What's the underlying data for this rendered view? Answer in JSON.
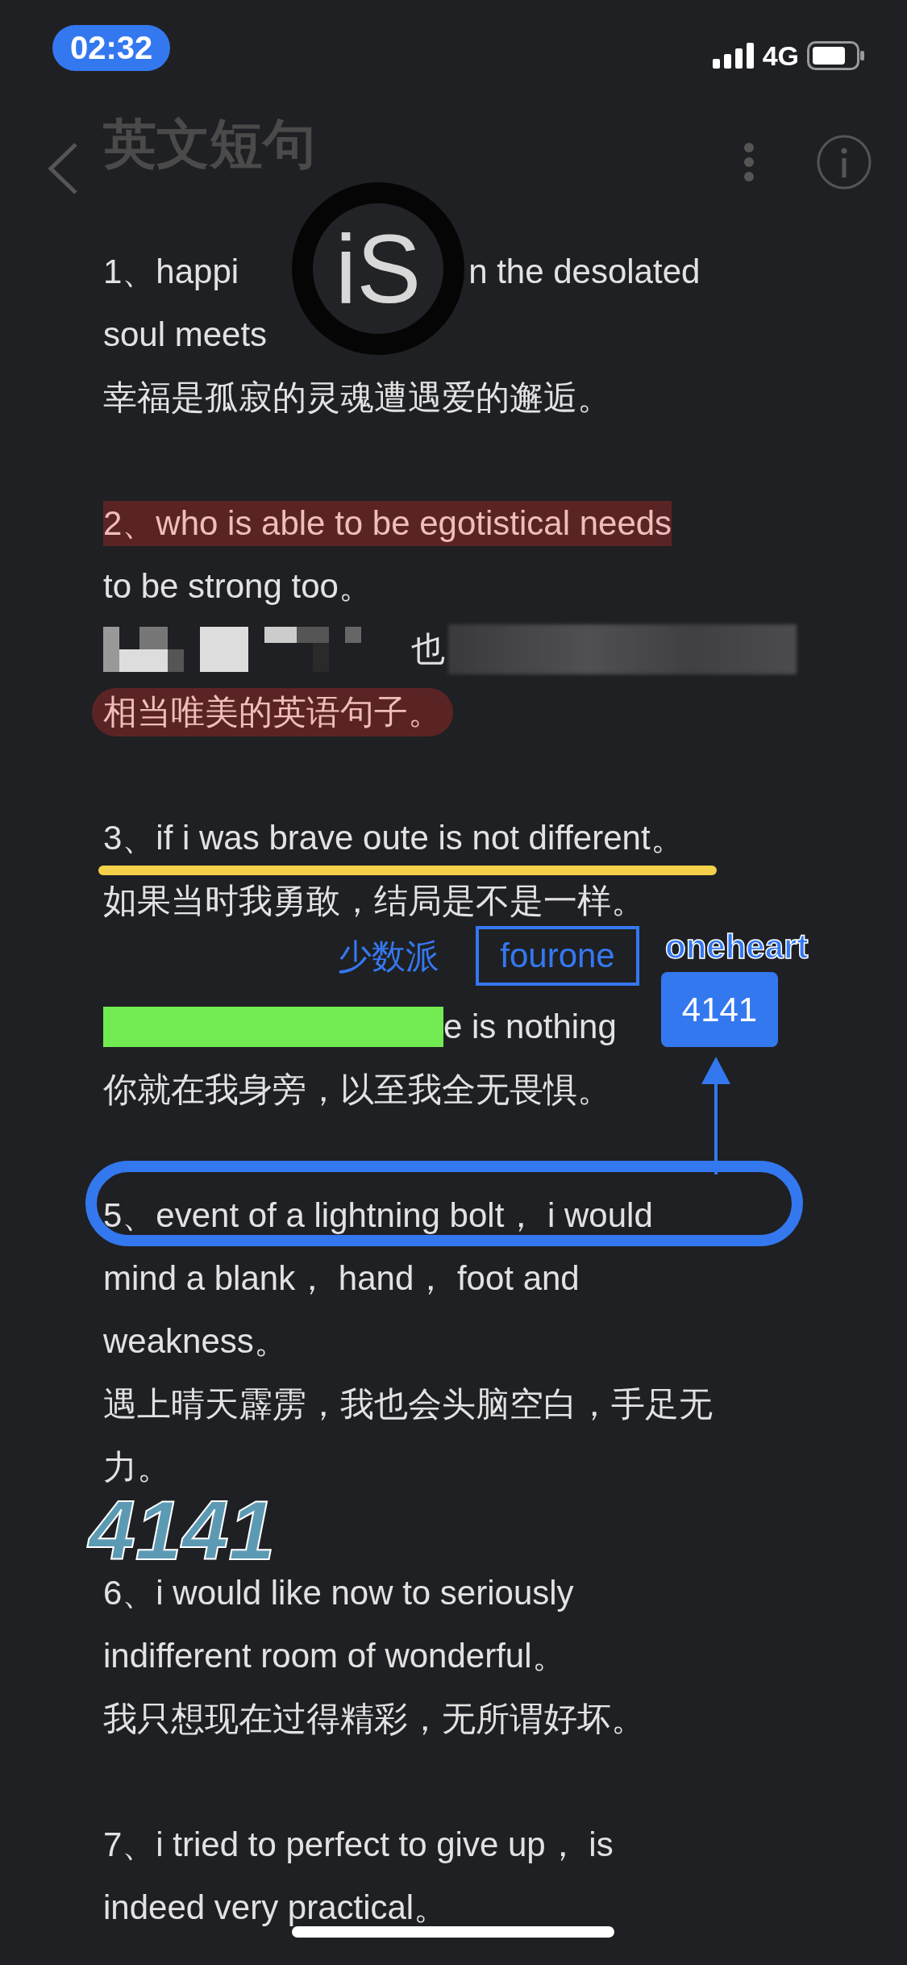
{
  "status_bar": {
    "time": "02:32",
    "network": "4G"
  },
  "nav": {
    "title": "英文短句"
  },
  "magnifier": {
    "text": "iS"
  },
  "paragraphs": [
    {
      "lines": [
        {
          "kind": "split",
          "parts": [
            "1、happi",
            "n the desolated"
          ]
        },
        {
          "kind": "text",
          "text": "soul meets"
        },
        {
          "kind": "text",
          "text": "幸福是孤寂的灵魂遭遇爱的邂逅。"
        }
      ]
    },
    {
      "lines": [
        {
          "kind": "highlight",
          "text": "2、who is able to be egotistical needs"
        },
        {
          "kind": "text",
          "text": "to be strong too。"
        },
        {
          "kind": "mixed",
          "segments": [
            {
              "kind": "pixelated"
            },
            {
              "kind": "text",
              "text": "也"
            },
            {
              "kind": "blurred"
            }
          ]
        },
        {
          "kind": "marker",
          "text": "相当唯美的英语句子。"
        }
      ]
    },
    {
      "lines": [
        {
          "kind": "underline",
          "text": "3、if i was brave oute is not different。"
        },
        {
          "kind": "text",
          "text": "如果当时我勇敢，结局是不是一样。"
        }
      ]
    },
    {
      "lines": [
        {
          "kind": "mixed",
          "segments": [
            {
              "kind": "green_bar"
            },
            {
              "kind": "text",
              "text": "e is nothing"
            }
          ]
        },
        {
          "kind": "text",
          "text": "你就在我身旁，以至我全无畏惧。"
        }
      ]
    },
    {
      "lines": [
        {
          "kind": "circled",
          "text": "5、event of a lightning bolt，  i would"
        },
        {
          "kind": "text",
          "text": "mind a blank，  hand，  foot and"
        },
        {
          "kind": "text",
          "text": "weakness。"
        },
        {
          "kind": "text",
          "text": "遇上晴天霹雳，我也会头脑空白，手足无"
        },
        {
          "kind": "text",
          "text": "力。"
        }
      ]
    },
    {
      "lines": [
        {
          "kind": "text",
          "text": "6、i would like now to seriously"
        },
        {
          "kind": "text",
          "text": "indifferent room of wonderful。"
        },
        {
          "kind": "text",
          "text": "我只想现在过得精彩，无所谓好坏。"
        }
      ]
    },
    {
      "lines": [
        {
          "kind": "text",
          "text": "7、i tried to perfect to give up，  is"
        },
        {
          "kind": "text",
          "text": "indeed very practical。"
        }
      ]
    }
  ],
  "annotations": {
    "label": "少数派",
    "boxed_label": "fourone",
    "outlined_label": "oneheart",
    "badge": "4141",
    "handwriting": "4141"
  }
}
